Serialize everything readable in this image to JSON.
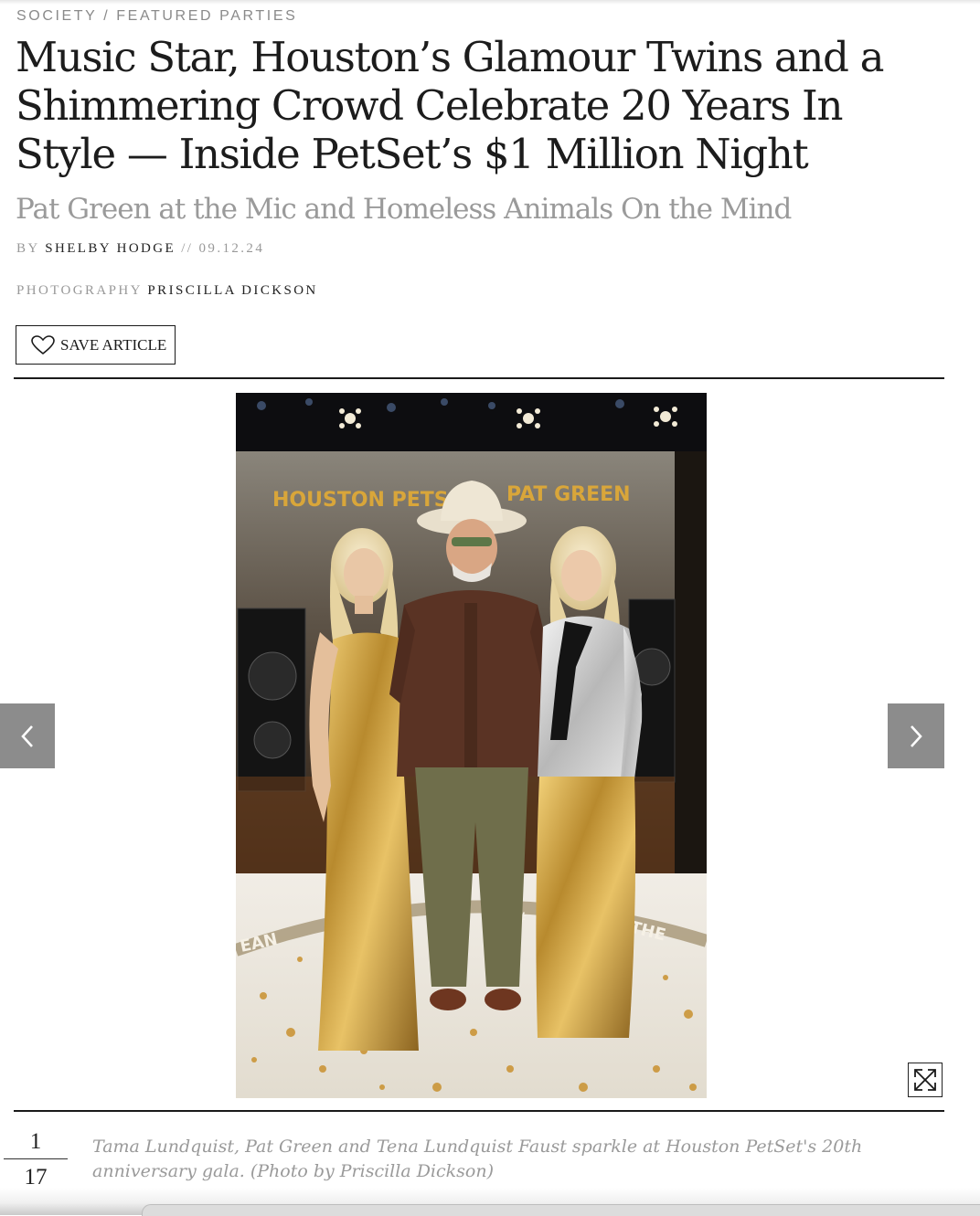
{
  "breadcrumb": {
    "section": "SOCIETY",
    "separator": "/",
    "subsection": "FEATURED PARTIES"
  },
  "article": {
    "headline": "Music Star, Houston’s Glamour Twins and a Shimmering Crowd Celebrate 20 Years In Style — Inside PetSet’s $1 Million Night",
    "subheadline": "Pat Green at the Mic and Homeless Animals On the Mind",
    "byline": {
      "prefix": "BY",
      "author": "SHELBY HODGE",
      "separator": "//",
      "date": "09.12.24"
    },
    "photo_credit": {
      "prefix": "PHOTOGRAPHY",
      "photographer": "PRISCILLA DICKSON"
    },
    "save_label": "SAVE ARTICLE"
  },
  "gallery": {
    "banner_left": "HOUSTON PETS",
    "banner_right": "PAT GREEN",
    "floor_left": "EAN",
    "floor_mid": "#",
    "floor_right": "THE",
    "current": "1",
    "total": "17",
    "caption": "Tama Lundquist, Pat Green and Tena Lundquist Faust sparkle at Houston PetSet's 20th anniversary gala. (Photo by Priscilla Dickson)"
  },
  "icons": {
    "save": "heart-icon",
    "prev": "chevron-left-icon",
    "next": "chevron-right-icon",
    "expand": "expand-icon"
  },
  "colors": {
    "nav_arrow_bg": "#8c8c8c",
    "subhead": "#9a9a9a",
    "gold_sequin": "#c9a14a",
    "banner_text": "#d9a63a"
  }
}
